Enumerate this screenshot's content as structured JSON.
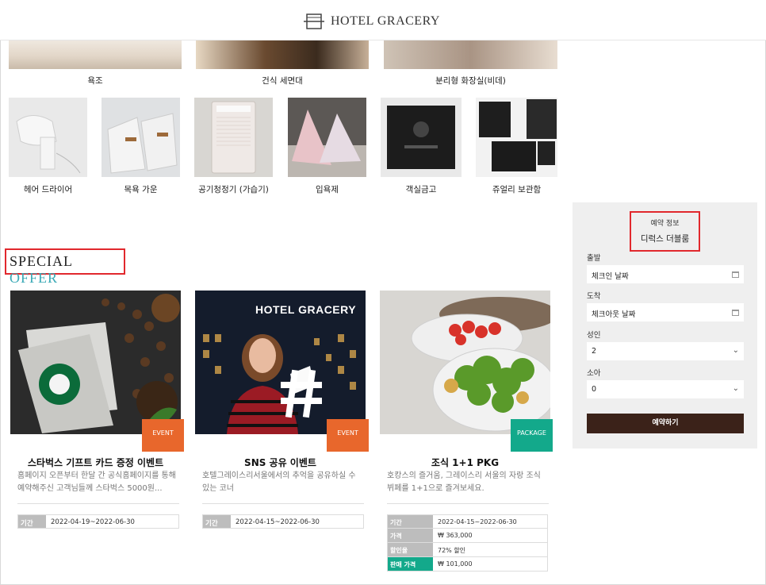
{
  "header": {
    "logo_text": "HOTEL GRACERY",
    "logo_icon": "hotel-logo-icon"
  },
  "top_amenities": [
    {
      "caption": "욕조"
    },
    {
      "caption": "건식 세면대"
    },
    {
      "caption": "분리형 화장실(비데)"
    }
  ],
  "amenities": [
    {
      "caption": "헤어 드라이어"
    },
    {
      "caption": "목욕 가운"
    },
    {
      "caption": "공기청정기 (가습기)"
    },
    {
      "caption": "입욕제"
    },
    {
      "caption": "객실금고"
    },
    {
      "caption": "쥬얼리 보관함"
    }
  ],
  "reservation": {
    "heading": "예약 정보",
    "room": "디럭스 더블룸",
    "checkin_label": "출발",
    "checkin_value": "체크인 날짜",
    "checkout_label": "도착",
    "checkout_value": "체크아웃 날짜",
    "adults_label": "성인",
    "adults_value": "2",
    "children_label": "소아",
    "children_value": "0",
    "submit_label": "예약하기"
  },
  "special_offer": {
    "title_a": "SPECIAL",
    "title_b": "OFFER"
  },
  "offers": [
    {
      "badge": "EVENT",
      "title": "스타벅스 기프트 카드 증정 이벤트",
      "desc": "홈페이지 오픈부터 한달 간 공식홈페이지를 통해 예약해주신 고객님들께 스타벅스 5000원...",
      "period_label": "기간",
      "period": "2022-04-19~2022-06-30"
    },
    {
      "badge": "EVENT",
      "title": "SNS 공유 이벤트",
      "desc": "호텔그레이스리서울에서의 추억을 공유하실 수 있는 코너",
      "period_label": "기간",
      "period": "2022-04-15~2022-06-30",
      "image_sign": "HOTEL GRACERY"
    },
    {
      "badge": "PACKAGE",
      "title": "조식 1+1 PKG",
      "desc": "호캉스의 즐거움, 그레이스리 서울의 자랑 조식 뷔페를 1+1으로 즐겨보세요.",
      "rows": [
        {
          "k": "기간",
          "v": "2022-04-15~2022-06-30"
        },
        {
          "k": "가격",
          "v": "₩ 363,000"
        },
        {
          "k": "할인율",
          "v": "72% 할인"
        },
        {
          "k": "판매 가격",
          "v": "₩ 101,000"
        }
      ]
    }
  ],
  "colors": {
    "accent_red": "#e1282d",
    "offer_teal": "#3aa9b6",
    "event_orange": "#e8672c",
    "package_green": "#13a98b",
    "button_brown": "#3b2219"
  }
}
